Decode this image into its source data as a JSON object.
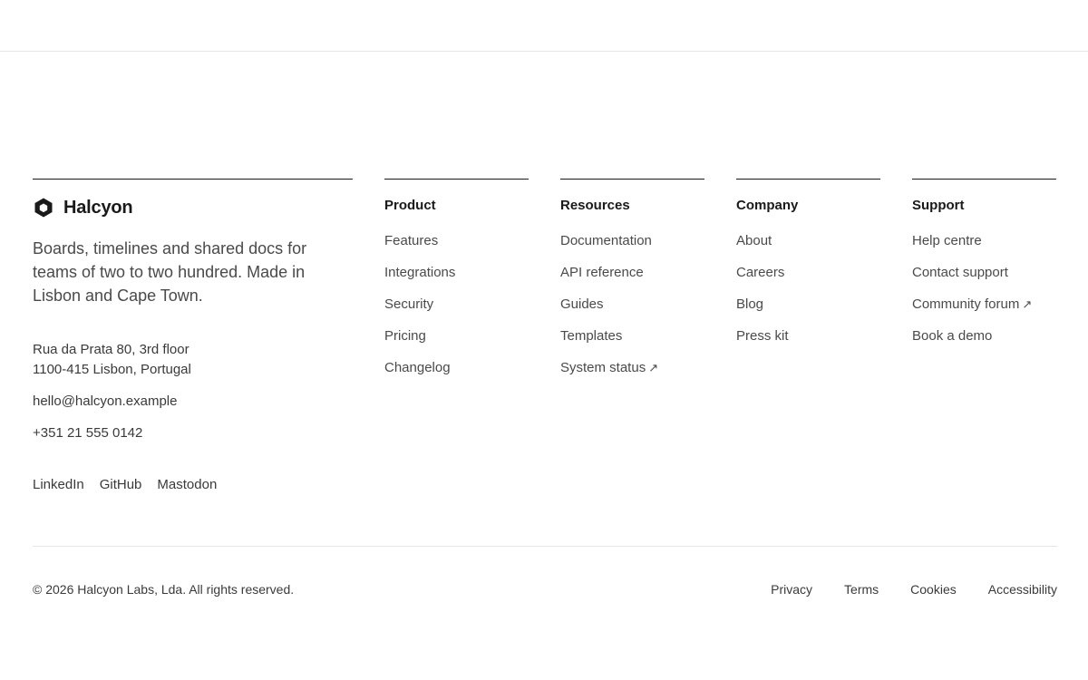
{
  "brand": {
    "name": "Halcyon",
    "icon": "hexagon-logo-icon",
    "tagline": "Boards, timelines and shared docs for teams of two to two hundred. Made in Lisbon and Cape Town.",
    "address_line1": "Rua da Prata 80, 3rd floor",
    "address_line2": "1100-415 Lisbon, Portugal",
    "email": "hello@halcyon.example",
    "phone": "+351 21 555 0142",
    "socials": [
      "LinkedIn",
      "GitHub",
      "Mastodon"
    ]
  },
  "columns": [
    {
      "heading": "Product",
      "links": [
        "Features",
        "Integrations",
        "Security",
        "Pricing",
        "Changelog"
      ]
    },
    {
      "heading": "Resources",
      "links": [
        "Documentation",
        "API reference",
        "Guides",
        "Templates",
        "System status"
      ]
    },
    {
      "heading": "Company",
      "links": [
        "About",
        "Careers",
        "Blog",
        "Press kit"
      ]
    },
    {
      "heading": "Support",
      "links": [
        "Help centre",
        "Contact support",
        "Community forum",
        "Book a demo"
      ]
    }
  ],
  "external_marker": "↗",
  "bottom": {
    "copyright": "© 2026 Halcyon Labs, Lda. All rights reserved.",
    "legal": [
      "Privacy",
      "Terms",
      "Cookies",
      "Accessibility"
    ]
  },
  "colors": {
    "text": "#3a3a3a",
    "heading": "#1a1a1a",
    "rule": "#e6e6e6"
  }
}
